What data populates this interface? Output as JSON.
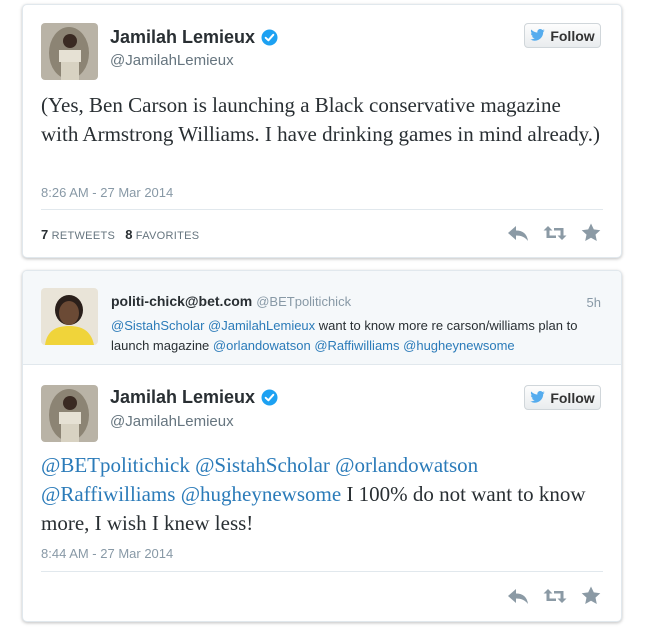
{
  "colors": {
    "link": "#2b7bb9",
    "verified": "#1da1f2",
    "follow_bird": "#55acee",
    "text": "#292f33",
    "muted": "#8899a6"
  },
  "tweet1": {
    "author_name": "Jamilah Lemieux",
    "handle": "@JamilahLemieux",
    "follow_label": "Follow",
    "text": "(Yes, Ben Carson is launching a Black conservative magazine with Armstrong Williams. I have drinking games in mind already.)",
    "timestamp": "8:26 AM - 27 Mar 2014",
    "retweets_count": "7",
    "retweets_label": "RETWEETS",
    "favorites_count": "8",
    "favorites_label": "FAVORITES"
  },
  "reply_context": {
    "author_name": "politi-chick@bet.com",
    "handle": "@BETpolitichick",
    "time": "5h",
    "mentions_lead": [
      "@SistahScholar",
      "@JamilahLemieux"
    ],
    "text_mid": "want to know more re carson/williams plan to launch magazine",
    "mentions_tail": [
      "@orlandowatson",
      "@Raffiwilliams",
      "@hugheynewsome"
    ]
  },
  "tweet2": {
    "author_name": "Jamilah Lemieux",
    "handle": "@JamilahLemieux",
    "follow_label": "Follow",
    "mentions": [
      "@BETpolitichick",
      "@SistahScholar",
      "@orlandowatson",
      "@Raffiwilliams",
      "@hugheynewsome"
    ],
    "text_rest": "I 100% do not want to know more, I wish I knew less!",
    "timestamp": "8:44 AM - 27 Mar 2014"
  },
  "icons": [
    "verified-badge-icon",
    "twitter-bird-icon",
    "reply-icon",
    "retweet-icon",
    "favorite-star-icon"
  ]
}
